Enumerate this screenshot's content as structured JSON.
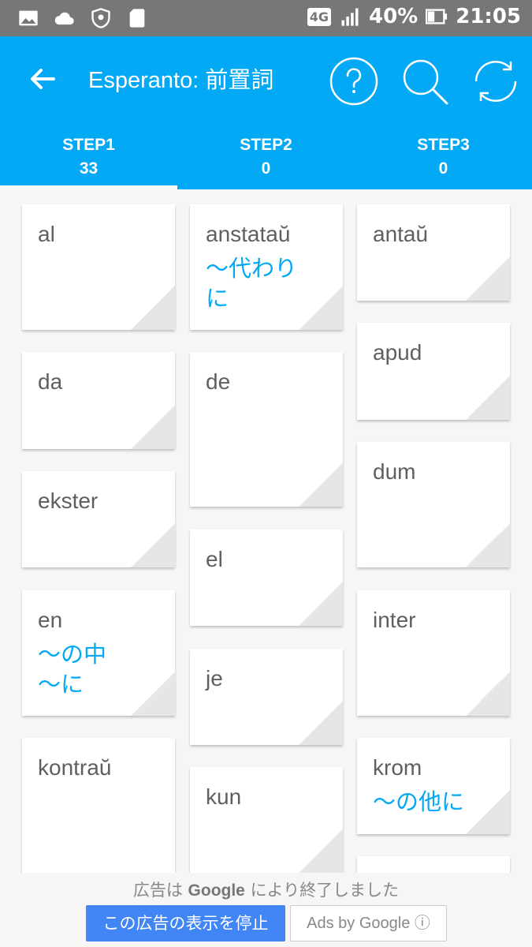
{
  "status_bar": {
    "network": "4G",
    "battery": "40%",
    "time": "21:05",
    "icons": [
      "image-icon",
      "cloud-icon",
      "shield-eye-icon",
      "sd-card-icon",
      "signal-icon",
      "battery-icon"
    ]
  },
  "app_bar": {
    "title": "Esperanto: 前置詞",
    "back_icon": "arrow-back-icon",
    "actions": [
      "help-icon",
      "search-icon",
      "refresh-icon"
    ],
    "color": "#03a9f4"
  },
  "tabs": [
    {
      "label": "STEP1",
      "count": "33"
    },
    {
      "label": "STEP2",
      "count": "0"
    },
    {
      "label": "STEP3",
      "count": "0"
    }
  ],
  "cards": {
    "col1": [
      {
        "word": "al",
        "meaning": ""
      },
      {
        "word": "da",
        "meaning": ""
      },
      {
        "word": "ekster",
        "meaning": ""
      },
      {
        "word": "en",
        "meaning": "〜の中\n〜に"
      },
      {
        "word": "kontraŭ",
        "meaning": ""
      }
    ],
    "col2": [
      {
        "word": "anstataŭ",
        "meaning": "〜代わり\nに"
      },
      {
        "word": "de",
        "meaning": ""
      },
      {
        "word": "el",
        "meaning": ""
      },
      {
        "word": "je",
        "meaning": ""
      },
      {
        "word": "kun",
        "meaning": ""
      }
    ],
    "col3": [
      {
        "word": "antaŭ",
        "meaning": ""
      },
      {
        "word": "apud",
        "meaning": ""
      },
      {
        "word": "dum",
        "meaning": ""
      },
      {
        "word": "inter",
        "meaning": ""
      },
      {
        "word": "krom",
        "meaning": "〜の他に"
      }
    ]
  },
  "ad": {
    "closed_prefix": "広告は",
    "closed_brand": "Google",
    "closed_suffix": "により終了しました",
    "stop_button": "この広告の表示を停止",
    "ads_by": "Ads by Google ⓘ"
  }
}
